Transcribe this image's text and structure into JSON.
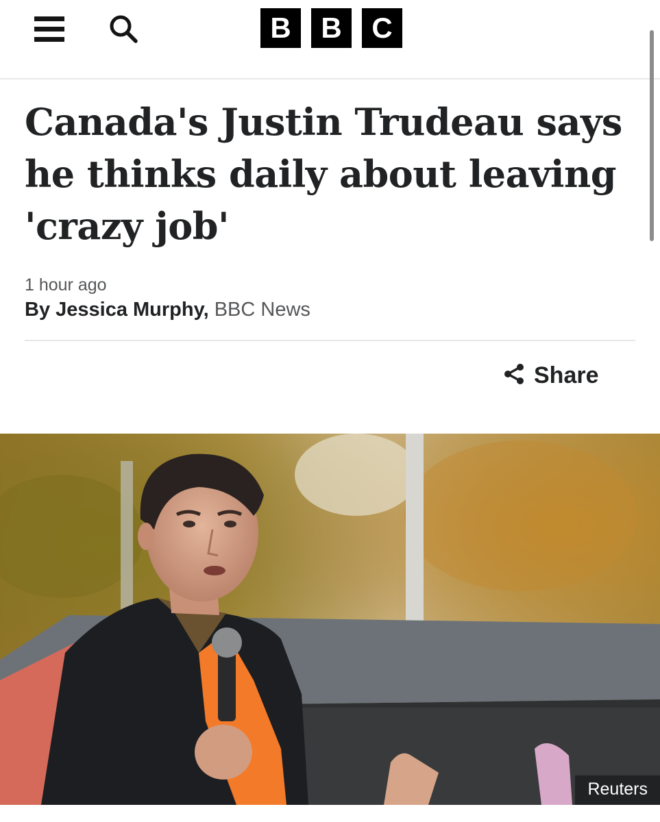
{
  "header": {
    "menu_icon": "menu-icon",
    "search_icon": "search-icon",
    "logo_letters": [
      "B",
      "B",
      "C"
    ]
  },
  "article": {
    "headline": "Canada's Justin Trudeau says he thinks daily about leaving 'crazy job'",
    "timestamp": "1 hour ago",
    "byline": {
      "prefix": "By Jessica Murphy,",
      "organisation": "BBC News"
    },
    "share": {
      "label": "Share",
      "icon": "share-icon"
    },
    "image": {
      "credit": "Reuters"
    }
  },
  "colors": {
    "text": "#202224",
    "secondary_text": "#545658",
    "logo_bg": "#000000",
    "divider": "#e6e7e8"
  }
}
